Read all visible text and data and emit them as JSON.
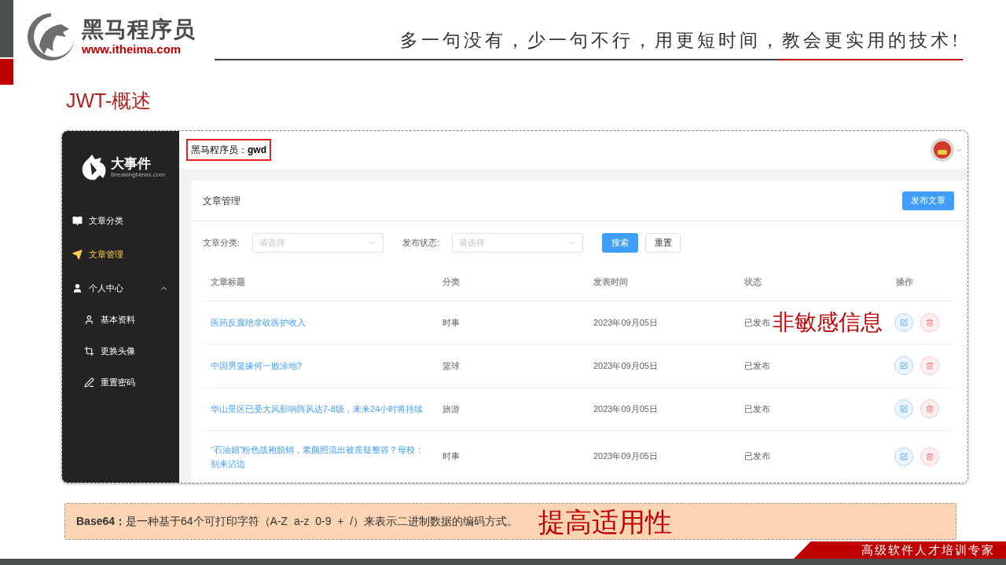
{
  "brand": {
    "name": "黑马程序员",
    "url": "www.itheima.com"
  },
  "tagline": "多一句没有，少一句不行，用更短时间，教会更实用的技术!",
  "title": "JWT-概述",
  "app": {
    "logo": {
      "name": "大事件",
      "sub": "BreakingNews.com"
    },
    "menu": [
      {
        "label": "文章分类",
        "selected": false
      },
      {
        "label": "文章管理",
        "selected": true
      },
      {
        "label": "个人中心",
        "selected": false,
        "expanded": true,
        "children": [
          {
            "label": "基本资料",
            "selected": false
          },
          {
            "label": "更换头像",
            "selected": false
          },
          {
            "label": "重置密码",
            "selected": false
          }
        ]
      }
    ],
    "user": "黑马程序员：**gwd**",
    "page_title": "文章管理",
    "publish_button": "发布文章",
    "filters": [
      {
        "label": "文章分类:",
        "placeholder": "请选择"
      },
      {
        "label": "发布状态:",
        "placeholder": "请选择"
      }
    ],
    "search_button": "搜索",
    "reset_button": "重置",
    "columns": [
      "文章标题",
      "分类",
      "发表时间",
      "状态",
      "操作"
    ],
    "rows": [
      {
        "title": "医药反腐绝非砍医护收入",
        "category": "时事",
        "date": "2023年09月05日",
        "status": "已发布"
      },
      {
        "title": "中国男篮缘何一败涂地?",
        "category": "篮球",
        "date": "2023年09月05日",
        "status": "已发布"
      },
      {
        "title": "华山景区已受大风影响阵风达7-8级，未来24小时将持续",
        "category": "旅游",
        "date": "2023年09月05日",
        "status": "已发布"
      },
      {
        "title": "“石油姐”粉色战袍脱销，素颜照流出被质疑整容？母校：别来沾边",
        "category": "时事",
        "date": "2023年09月05日",
        "status": "已发布"
      }
    ],
    "callout": "非敏感信息"
  },
  "note": {
    "text": "**Base64：**是一种基于64个可打印字符（A-Z  a-z  0-9  +  /）来表示二进制数据的编码方式。",
    "callout": "提高适用性"
  },
  "footer": {
    "banner": "高级软件人才培训专家"
  }
}
